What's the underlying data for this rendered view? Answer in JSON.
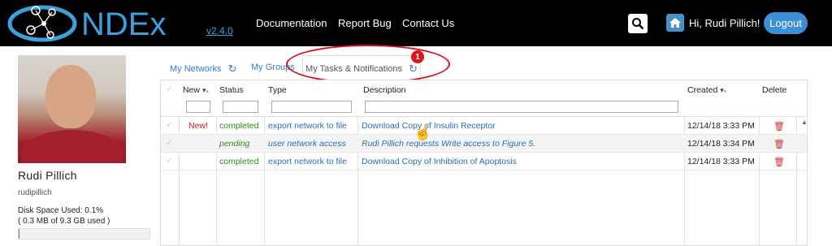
{
  "app": {
    "brand": "NDEx",
    "version": "v2.4.0"
  },
  "nav": {
    "links": [
      "Documentation",
      "Report Bug",
      "Contact Us"
    ],
    "greeting": "Hi, Rudi Pillich!",
    "logout": "Logout",
    "icons": [
      "search-icon",
      "home-icon"
    ]
  },
  "profile": {
    "name": "Rudi Pillich",
    "username": "rudipillich",
    "disk_label": "Disk Space Used: 0.1%",
    "disk_detail": "( 0.3 MB of 9.3 GB used )",
    "disk_used_fraction": 0.001
  },
  "tabs": [
    {
      "label": "My Networks",
      "active": false
    },
    {
      "label": "My Groups",
      "active": false
    },
    {
      "label": "My Tasks & Notifications",
      "active": true
    }
  ],
  "notification_badge": "1",
  "table": {
    "headers": {
      "new": "New",
      "status": "Status",
      "type": "Type",
      "description": "Description",
      "created": "Created",
      "delete": "Delete",
      "sort_indicator": "▾ₛ"
    },
    "rows": [
      {
        "new": "New!",
        "status": "completed",
        "type": "export network to file",
        "description": "Download Copy of Insulin Receptor",
        "created": "12/14/18 3:33 PM"
      },
      {
        "new": "",
        "status": "pending",
        "type": "user network access",
        "description": "Rudi Pillich requests Write access to Figure 5.",
        "created": "12/14/18 3:34 PM"
      },
      {
        "new": "",
        "status": "completed",
        "type": "export network to file",
        "description": "Download Copy of Inhibition of Apoptosis",
        "created": "12/14/18 3:33 PM"
      }
    ]
  },
  "colors": {
    "navbar": "#000000",
    "accent": "#3b8fd6",
    "link": "#2a6db2",
    "status_green": "#2f8a1e",
    "alert_red": "#e0141a"
  }
}
